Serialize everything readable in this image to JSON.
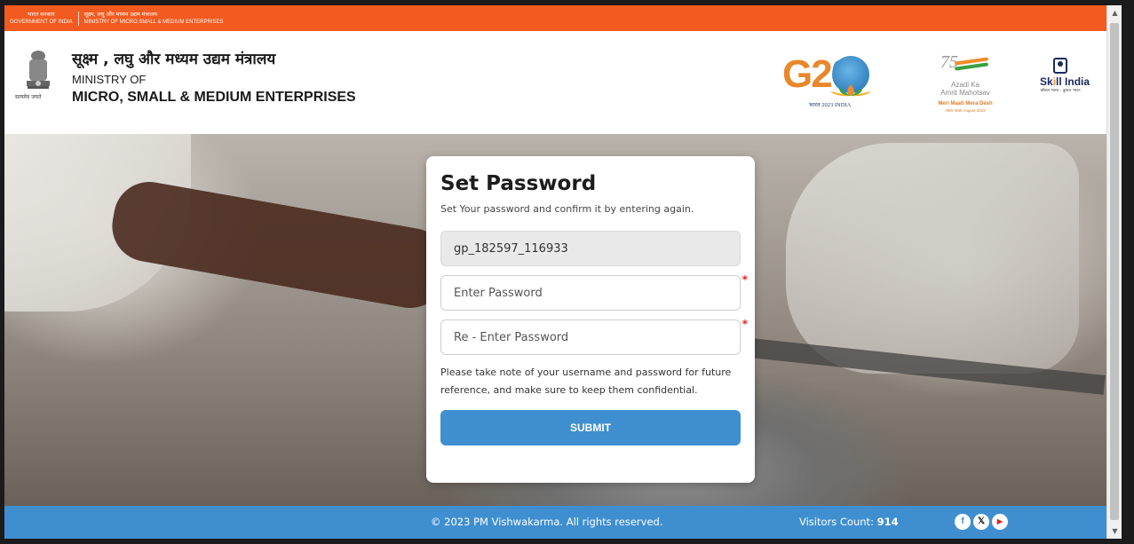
{
  "govbar": {
    "gov_hindi": "भारत सरकार",
    "gov_english": "GOVERNMENT OF INDIA",
    "ministry_hindi": "सूक्ष्म, लघु और मध्यम उद्यम मंत्रालय",
    "ministry_english": "MINISTRY OF MICRO,SMALL & MEDIUM ENTERPRISES"
  },
  "header": {
    "emblem_caption": "सत्यमेव जयते",
    "ministry_hindi": "सूक्ष्म , लघु और मध्यम उद्यम मंत्रालय",
    "ministry_of": "MINISTRY OF",
    "ministry_name": "MICRO, SMALL & MEDIUM ENTERPRISES",
    "g20_tagline": "भारत 2023 INDIA",
    "azadi_line1": "Azadi Ka",
    "azadi_line2": "Amrit Mahotsav",
    "azadi_line3": "Meri Maati Mera Desh",
    "azadi_line4": "09th-30th August 2023",
    "skill_sub": "कौशल भारत - कुशल भारत"
  },
  "form": {
    "title": "Set Password",
    "subtitle": "Set Your password and confirm it by entering again.",
    "username_value": "gp_182597_116933",
    "password_placeholder": "Enter Password",
    "repassword_placeholder": "Re - Enter Password",
    "required_mark": "*",
    "note": "Please take note of your username and password for future reference, and make sure to keep them confidential.",
    "submit_label": "SUBMIT"
  },
  "footer": {
    "copyright": "© 2023 PM Vishwakarma. All rights reserved.",
    "visitors_label": "Visitors Count: ",
    "visitors_count": "914"
  },
  "colors": {
    "govbar": "#f25a1f",
    "primary": "#3f8fd0",
    "required": "#e02424"
  },
  "icons": [
    "ashoka-emblem-icon",
    "g20-logo-icon",
    "azadi-logo-icon",
    "skill-india-icon",
    "facebook-icon",
    "x-twitter-icon",
    "youtube-icon"
  ]
}
